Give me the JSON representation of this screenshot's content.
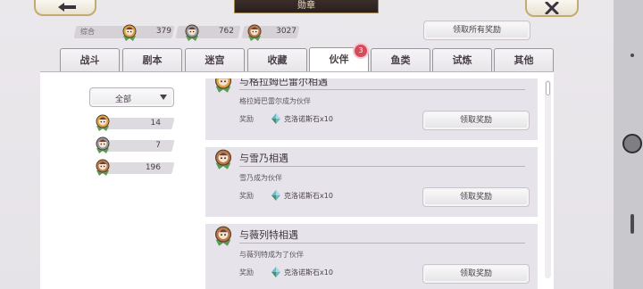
{
  "title": "勋章",
  "summary": {
    "label": "综合",
    "gold": "379",
    "silver": "762",
    "bronze": "3027"
  },
  "claim_all_label": "领取所有奖励",
  "tabs": [
    {
      "label": "战斗"
    },
    {
      "label": "剧本"
    },
    {
      "label": "迷宫"
    },
    {
      "label": "收藏"
    },
    {
      "label": "伙伴"
    },
    {
      "label": "鱼类"
    },
    {
      "label": "试炼"
    },
    {
      "label": "其他"
    }
  ],
  "active_tab": "伙伴",
  "tab_badge": "3",
  "filter": {
    "selected": "全部",
    "counts": [
      {
        "tier": "gold",
        "value": "14"
      },
      {
        "tier": "silver",
        "value": "7"
      },
      {
        "tier": "bronze",
        "value": "196"
      }
    ]
  },
  "reward_label": "奖励",
  "claim_label": "领取奖励",
  "cards": [
    {
      "title": "与格拉姆巴雷尔相遇",
      "desc": "格拉姆巴雷尔成为伙伴",
      "reward": "克洛诺斯石x10"
    },
    {
      "title": "与雪乃相遇",
      "desc": "雪乃成为伙伴",
      "reward": "克洛诺斯石x10"
    },
    {
      "title": "与薇列特相遇",
      "desc": "与薇列特成为了伙伴",
      "reward": "克洛诺斯石x10"
    }
  ],
  "colors": {
    "gold": "#d9a441",
    "silver": "#8e98a6",
    "bronze": "#b9784a",
    "badge": "#d64a5a"
  }
}
